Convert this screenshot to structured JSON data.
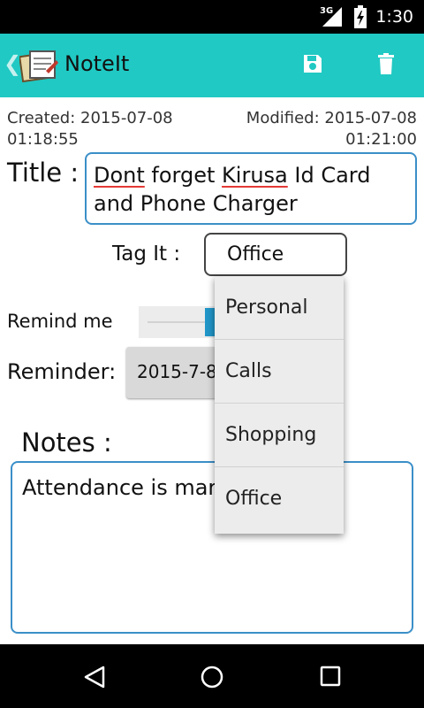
{
  "status_bar": {
    "network": "3G",
    "time": "1:30"
  },
  "action_bar": {
    "title": "NoteIt"
  },
  "meta": {
    "created_label": "Created: 2015-07-08",
    "created_time": "01:18:55",
    "modified_label": "Modified: 2015-07-08",
    "modified_time": "01:21:00"
  },
  "form": {
    "title_label": "Title :",
    "title_words": [
      "Dont",
      " forget ",
      "Kirusa",
      " Id Card"
    ],
    "title_line2": "and Phone Charger",
    "tag_label": "Tag It :",
    "tag_value": "Office",
    "remind_label": "Remind me",
    "reminder_label": "Reminder:",
    "reminder_date": "2015-7-8",
    "notes_label": "Notes :",
    "notes_value": "Attendance is mar"
  },
  "tag_options": [
    "Personal",
    "Calls",
    "Shopping",
    "Office"
  ],
  "colors": {
    "accent": "#20c9c3",
    "field_border": "#3b8fc8",
    "switch_on": "#2196c8"
  }
}
